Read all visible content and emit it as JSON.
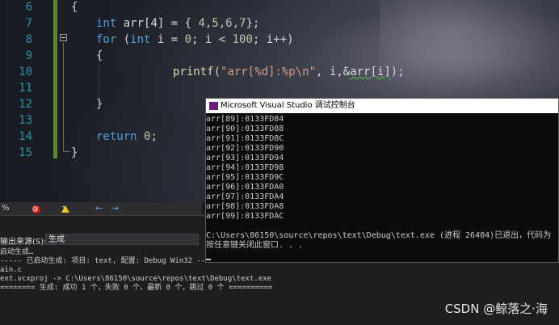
{
  "editor": {
    "line_numbers": [
      "6",
      "7",
      "8",
      "9",
      "10",
      "11",
      "12",
      "13",
      "14",
      "15"
    ],
    "lines": {
      "l6": "{",
      "l7_kw": "int",
      "l7_rest": " arr[4] = { ",
      "l7_nums": "4,5,6,7",
      "l7_end": "};",
      "l8_kw": "for",
      "l8_a": " (",
      "l8_kw2": "int",
      "l8_b": " i = ",
      "l8_n1": "0",
      "l8_c": "; i < ",
      "l8_n2": "100",
      "l8_d": "; i++)",
      "l9": "{",
      "l10_fn": "printf",
      "l10_a": "(",
      "l10_str": "\"arr[%d]:%p\\n\"",
      "l10_b": ", i,&",
      "l10_sq": "arr[i]",
      "l10_c": ");",
      "l12": "}",
      "l14_kw": "return",
      "l14_n": " 0",
      "l14_end": ";",
      "l15": "}"
    }
  },
  "statusbar": {
    "zoom": "%",
    "errors": "0",
    "warnings": "1",
    "nav_back": "←",
    "nav_forward": "→"
  },
  "output_panel": {
    "source_label": "输出来源(S):",
    "source_value": "生成",
    "lines": [
      "启动生成…",
      "----- 已启动生成: 项目: text, 配置: Debug Win32 -----",
      "ain.c",
      "ext.vcxproj -> C:\\Users\\86150\\source\\repos\\text\\Debug\\text.exe",
      "======== 生成: 成功 1 个，失败 0 个，最新 0 个，跳过 0 个 =========="
    ]
  },
  "console": {
    "title": "Microsoft Visual Studio 调试控制台",
    "output": [
      "arr[89]:0133FD84",
      "arr[90]:0133FD88",
      "arr[91]:0133FD8C",
      "arr[92]:0133FD90",
      "arr[93]:0133FD94",
      "arr[94]:0133FD98",
      "arr[95]:0133FD9C",
      "arr[96]:0133FDA0",
      "arr[97]:0133FDA4",
      "arr[98]:0133FDA8",
      "arr[99]:0133FDAC",
      "",
      "C:\\Users\\86150\\source\\repos\\text\\Debug\\text.exe (进程 26404)已退出，代码为",
      "按任意键关闭此窗口. . ."
    ]
  },
  "watermark": "CSDN @鲸落之·海",
  "colors": {
    "keyword": "#569cd6",
    "number": "#b5cea8",
    "string": "#d69d85",
    "function": "#dcdcaa",
    "line_number": "#2b91af",
    "change_bar": "#5a8a32",
    "console_bg": "#0c0c0c"
  }
}
